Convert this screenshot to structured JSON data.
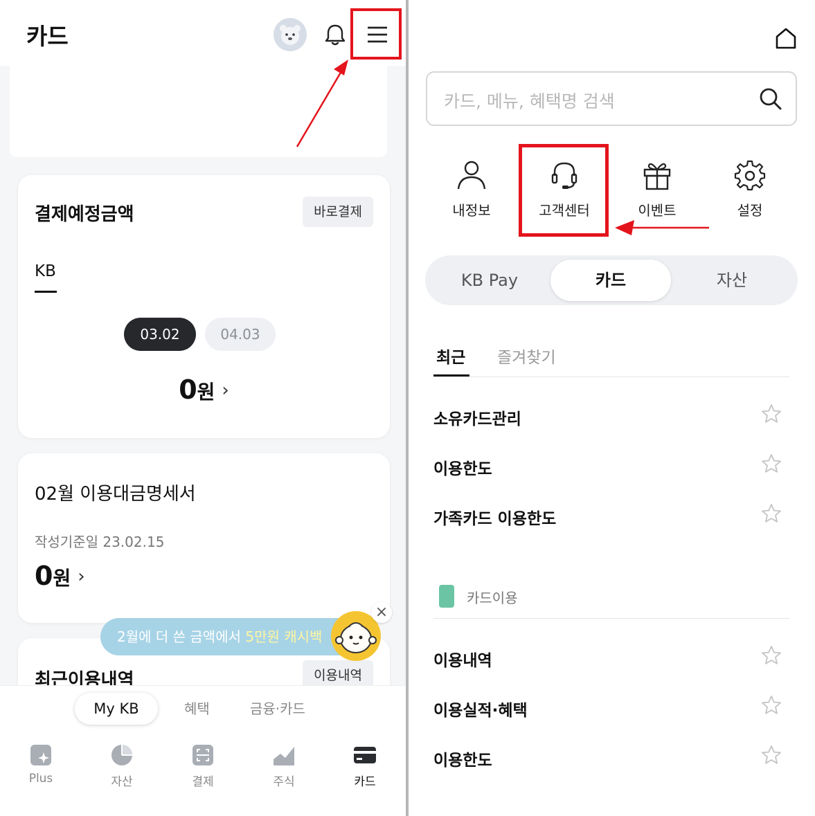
{
  "left": {
    "header": {
      "title": "카드"
    },
    "payment_card": {
      "title": "결제예정금액",
      "pay_now": "바로결제",
      "tab": "KB",
      "dates": [
        "03.02",
        "04.03"
      ],
      "amount": "0",
      "unit": "원"
    },
    "statement_card": {
      "title": "02월 이용대금명세서",
      "basis": "작성기준일 23.02.15",
      "amount": "0",
      "unit": "원"
    },
    "recent_card": {
      "title": "최근이용내역",
      "button": "이용내역"
    },
    "promo": {
      "prefix": "2월에 더 쓴 금액에서 ",
      "highlight": "5만원 캐시백",
      "close": "×"
    },
    "segments": [
      "My KB",
      "혜택",
      "금융·카드"
    ],
    "nav": [
      {
        "label": "Plus",
        "icon": "plus-star-icon"
      },
      {
        "label": "자산",
        "icon": "pie-chart-icon"
      },
      {
        "label": "결제",
        "icon": "scan-icon"
      },
      {
        "label": "주식",
        "icon": "stock-chart-icon"
      },
      {
        "label": "카드",
        "icon": "card-icon",
        "active": true
      }
    ]
  },
  "right": {
    "search": {
      "placeholder": "카드, 메뉴, 혜택명 검색"
    },
    "quick_menu": [
      {
        "label": "내정보",
        "icon": "person-icon"
      },
      {
        "label": "고객센터",
        "icon": "headset-icon"
      },
      {
        "label": "이벤트",
        "icon": "gift-icon"
      },
      {
        "label": "설정",
        "icon": "gear-icon"
      }
    ],
    "segments": [
      "KB Pay",
      "카드",
      "자산"
    ],
    "tabs": [
      "최근",
      "즐겨찾기"
    ],
    "recent_items": [
      "소유카드관리",
      "이용한도",
      "가족카드 이용한도"
    ],
    "section": {
      "title": "카드이용",
      "items": [
        "이용내역",
        "이용실적·혜택",
        "이용한도"
      ]
    }
  },
  "colors": {
    "highlight_red": "#e4141c",
    "dark_chip": "#26282c",
    "promo_blue": "#a7d3e6",
    "mascot_yellow": "#f5c531",
    "section_green": "#6bc5a4"
  }
}
